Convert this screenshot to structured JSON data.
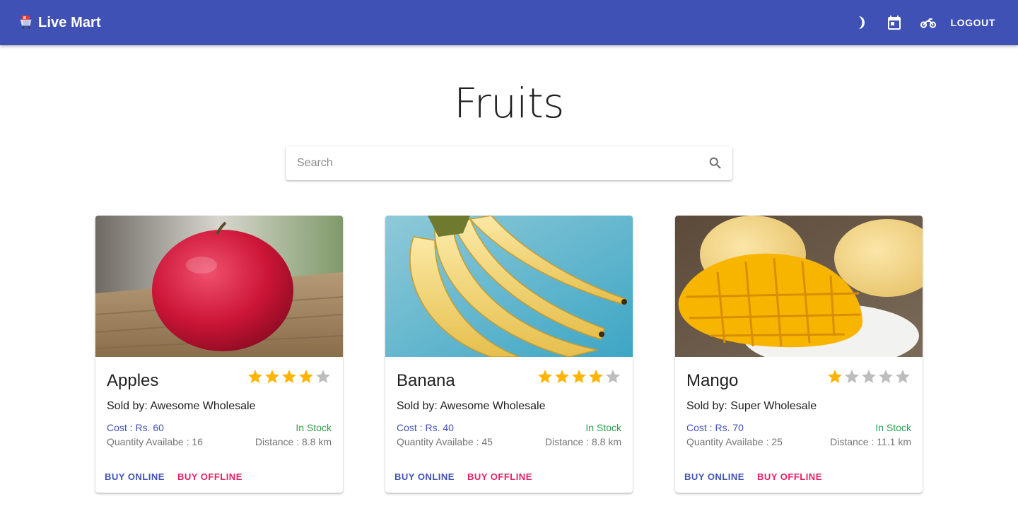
{
  "app": {
    "title": "Live Mart",
    "logo_icon": "shopping-cart-icon"
  },
  "toolbar": {
    "theme_icon": "moon-icon",
    "calendar_icon": "calendar-icon",
    "delivery_icon": "motorbike-icon",
    "logout_label": "LOGOUT"
  },
  "page": {
    "title": "Fruits"
  },
  "search": {
    "placeholder": "Search",
    "value": "",
    "icon": "search-icon"
  },
  "colors": {
    "primary": "#3f51b5",
    "secondary": "#e91e63",
    "in_stock": "#2e9e4a",
    "star_filled": "#ffb400",
    "star_empty": "#bdbdbd"
  },
  "products": [
    {
      "name": "Apples",
      "image": "apple-photo",
      "rating": 4,
      "rating_max": 5,
      "seller": "Sold by: Awesome Wholesale",
      "cost": "Cost : Rs. 60",
      "stock": "In Stock",
      "quantity": "Quantity Availabe : 16",
      "distance": "Distance : 8.8 km",
      "buy_online": "BUY ONLINE",
      "buy_offline": "BUY OFFLINE"
    },
    {
      "name": "Banana",
      "image": "banana-photo",
      "rating": 4,
      "rating_max": 5,
      "seller": "Sold by: Awesome Wholesale",
      "cost": "Cost : Rs. 40",
      "stock": "In Stock",
      "quantity": "Quantity Availabe : 45",
      "distance": "Distance : 8.8 km",
      "buy_online": "BUY ONLINE",
      "buy_offline": "BUY OFFLINE"
    },
    {
      "name": "Mango",
      "image": "mango-photo",
      "rating": 1,
      "rating_max": 5,
      "seller": "Sold by: Super Wholesale",
      "cost": "Cost : Rs. 70",
      "stock": "In Stock",
      "quantity": "Quantity Availabe : 25",
      "distance": "Distance : 11.1 km",
      "buy_online": "BUY ONLINE",
      "buy_offline": "BUY OFFLINE"
    }
  ]
}
